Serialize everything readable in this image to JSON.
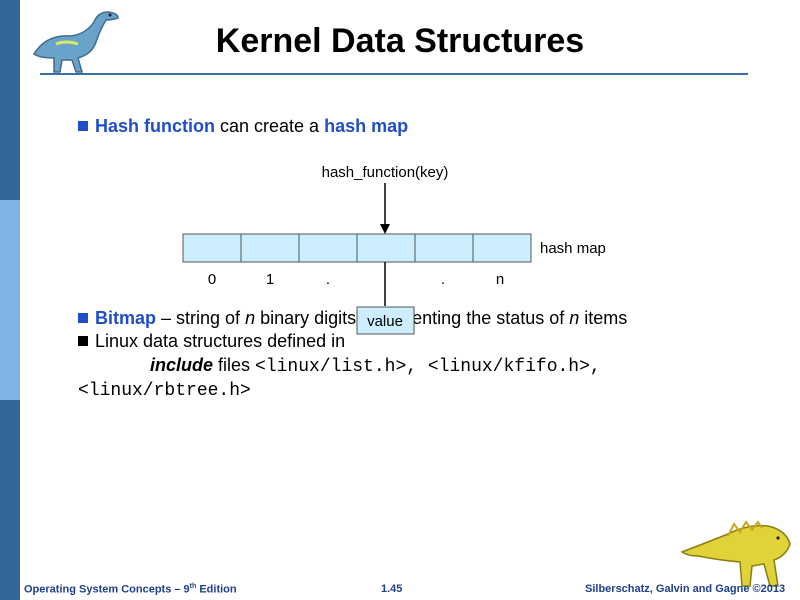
{
  "slide": {
    "title": "Kernel Data Structures",
    "bullet1": {
      "term1": "Hash function",
      "mid": " can create a ",
      "term2": "hash map"
    },
    "diagram": {
      "function_label": "hash_function(key)",
      "map_label": "hash map",
      "indices": [
        "0",
        "1",
        ".",
        ".",
        "n"
      ],
      "value_label": "value",
      "cell_count": 6
    },
    "bullet2": {
      "term": "Bitmap",
      "text_a": " – string of ",
      "n1": "n",
      "text_b": " binary digits representing the status of ",
      "n2": "n",
      "text_c": " items"
    },
    "bullet3": {
      "line1": "Linux data structures defined in",
      "include_word": "include",
      "files_word": " files ",
      "file1": "<linux/list.h>",
      "sep1": ", ",
      "file2": "<linux/kfifo.h>",
      "sep2": ",",
      "file3": "<linux/rbtree.h>"
    }
  },
  "footer": {
    "left_prefix": "Operating System Concepts – 9",
    "left_sup": "th",
    "left_suffix": " Edition",
    "center": "1.45",
    "right": "Silberschatz, Galvin and Gagne ©2013"
  },
  "colors": {
    "bar_dark": "#336699",
    "bar_light": "#7fb2e5",
    "cell_fill": "#cceeff",
    "accent": "#1f4ec8",
    "footer": "#1f3f8c"
  }
}
